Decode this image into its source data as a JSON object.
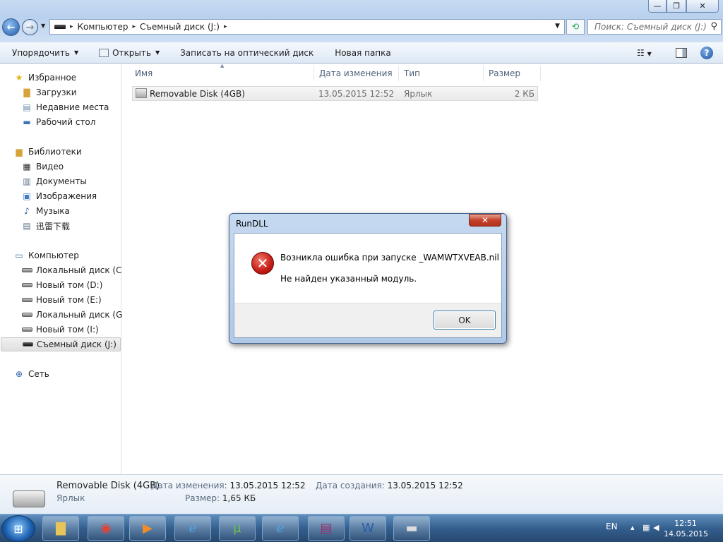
{
  "window": {
    "address": [
      "Компьютер",
      "Съемный диск (J:)"
    ],
    "search_placeholder": "Поиск: Съемный диск (J:)",
    "min_glyph": "—",
    "max_glyph": "❐",
    "close_glyph": "✕"
  },
  "toolbar": {
    "organize": "Упорядочить",
    "open": "Открыть",
    "burn": "Записать на оптический диск",
    "new_folder": "Новая папка"
  },
  "sidebar": {
    "favorites": "Избранное",
    "downloads": "Загрузки",
    "recent": "Недавние места",
    "desktop": "Рабочий стол",
    "libraries": "Библиотеки",
    "video": "Видео",
    "documents": "Документы",
    "pictures": "Изображения",
    "music": "Музыка",
    "xunlei": "迅雷下载",
    "computer": "Компьютер",
    "drive_c": "Локальный диск (C:)",
    "drive_d": "Новый том (D:)",
    "drive_e": "Новый том (E:)",
    "drive_g": "Локальный диск (G:)",
    "drive_i": "Новый том (I:)",
    "drive_j": "Съемный диск (J:)",
    "network": "Сеть"
  },
  "columns": {
    "name": "Имя",
    "modified": "Дата изменения",
    "type": "Тип",
    "size": "Размер"
  },
  "files": [
    {
      "name": "Removable Disk (4GB)",
      "modified": "13.05.2015 12:52",
      "type": "Ярлык",
      "size": "2 КБ"
    }
  ],
  "details": {
    "name": "Removable Disk (4GB)",
    "type": "Ярлык",
    "modified_label": "Дата изменения:",
    "modified_value": "13.05.2015 12:52",
    "size_label": "Размер:",
    "size_value": "1,65 КБ",
    "created_label": "Дата создания:",
    "created_value": "13.05.2015 12:52"
  },
  "dialog": {
    "title": "RunDLL",
    "line1": "Возникла ошибка при запуске _WAMWTXVEAB.nil",
    "line2": "Не найден указанный модуль.",
    "ok": "OK"
  },
  "taskbar": {
    "lang": "EN",
    "time": "12:51",
    "date": "14.05.2015"
  }
}
